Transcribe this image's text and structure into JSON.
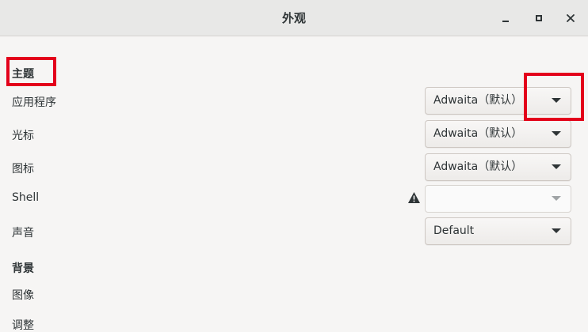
{
  "window": {
    "title": "外观",
    "controls": {
      "minimize_icon": "minimize-icon",
      "maximize_icon": "maximize-icon",
      "close_icon": "close-icon"
    }
  },
  "themes": {
    "header": "主题",
    "rows": [
      {
        "label": "应用程序",
        "value": "Adwaita（默认）"
      },
      {
        "label": "光标",
        "value": "Adwaita（默认）"
      },
      {
        "label": "图标",
        "value": "Adwaita（默认）"
      },
      {
        "label": "Shell",
        "value": "",
        "warning_icon": "warning-icon"
      },
      {
        "label": "声音",
        "value": "Default"
      }
    ]
  },
  "background": {
    "header": "背景",
    "rows": [
      {
        "label": "图像"
      },
      {
        "label": "调整"
      }
    ]
  },
  "colors": {
    "highlight": "#e3001b",
    "titlebar": "#e8e8e7",
    "window_bg": "#f6f5f4"
  }
}
